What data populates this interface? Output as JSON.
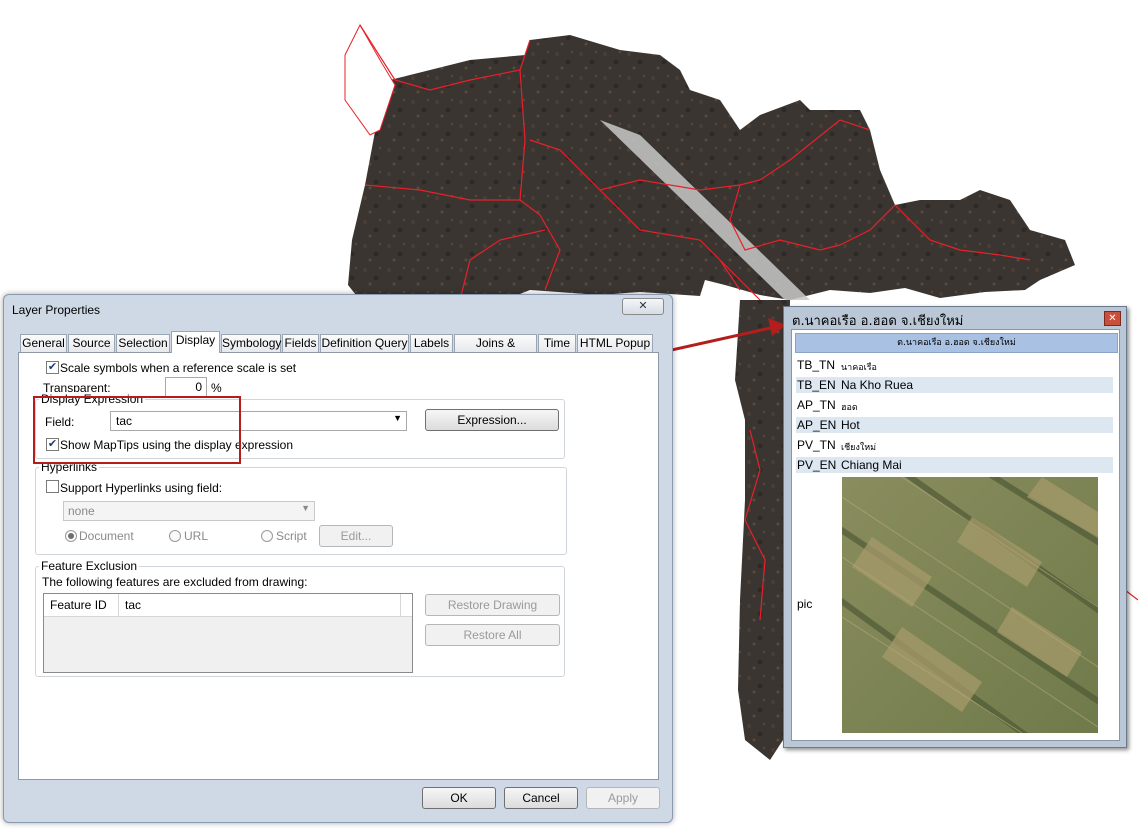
{
  "dialog": {
    "title": "Layer Properties",
    "tabs": [
      "General",
      "Source",
      "Selection",
      "Display",
      "Symbology",
      "Fields",
      "Definition Query",
      "Labels",
      "Joins & Relates",
      "Time",
      "HTML Popup"
    ],
    "active_tab": "Display",
    "scale_symbols_label": "Scale symbols when a reference scale is set",
    "scale_symbols_checked": true,
    "transparent_label": "Transparent:",
    "transparent_value": "0",
    "transparent_unit": "%",
    "display_expression": {
      "title": "Display Expression",
      "field_label": "Field:",
      "field_value": "tac",
      "expression_button": "Expression...",
      "show_maptips_label": "Show MapTips using the display expression",
      "show_maptips_checked": true
    },
    "hyperlinks": {
      "title": "Hyperlinks",
      "support_label": "Support Hyperlinks using field:",
      "support_checked": false,
      "field_value": "none",
      "options": [
        "Document",
        "URL",
        "Script"
      ],
      "selected_option": "Document",
      "edit_button": "Edit..."
    },
    "feature_exclusion": {
      "title": "Feature Exclusion",
      "description": "The following features are excluded from drawing:",
      "columns": [
        "Feature ID",
        "tac"
      ],
      "restore_drawing_button": "Restore Drawing",
      "restore_all_button": "Restore All"
    },
    "ok_button": "OK",
    "cancel_button": "Cancel",
    "apply_button": "Apply"
  },
  "maptip": {
    "title": "ต.นาคอเรือ อ.ฮอด จ.เชียงใหม่",
    "header": "ต.นาคอเรือ อ.ฮอด จ.เชียงใหม่",
    "rows": [
      {
        "key": "TB_TN",
        "value": "นาคอเรือ"
      },
      {
        "key": "TB_EN",
        "value": "Na Kho Ruea"
      },
      {
        "key": "AP_TN",
        "value": "ฮอด"
      },
      {
        "key": "AP_EN",
        "value": "Hot"
      },
      {
        "key": "PV_TN",
        "value": "เชียงใหม่"
      },
      {
        "key": "PV_EN",
        "value": "Chiang Mai"
      }
    ],
    "pic_label": "pic"
  },
  "colors": {
    "boundary": "#e8202a",
    "arrow": "#b51d1d",
    "map_dark": "#3a3430",
    "dialog_frame": "#cfd9e6"
  }
}
